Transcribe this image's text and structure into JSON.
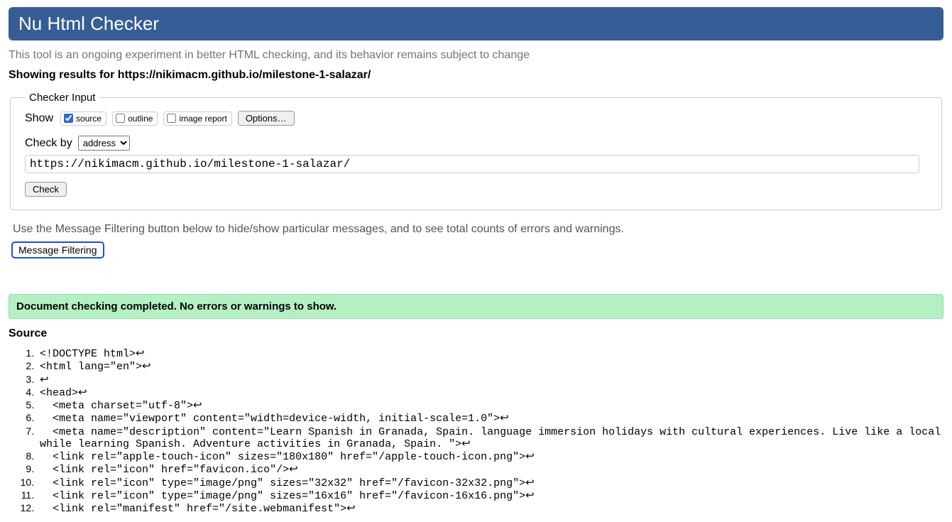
{
  "header": {
    "title": "Nu Html Checker"
  },
  "intro": "This tool is an ongoing experiment in better HTML checking, and its behavior remains subject to change",
  "showing": "Showing results for https://nikimacm.github.io/milestone-1-salazar/",
  "checker": {
    "legend": "Checker Input",
    "show_label": "Show",
    "cb_source": "source",
    "cb_outline": "outline",
    "cb_image_report": "image report",
    "options_btn": "Options…",
    "check_by_label": "Check by",
    "check_by_options": [
      "address"
    ],
    "check_by_selected": "address",
    "url_value": "https://nikimacm.github.io/milestone-1-salazar/",
    "check_btn": "Check"
  },
  "filter_hint": "Use the Message Filtering button below to hide/show particular messages, and to see total counts of errors and warnings.",
  "msg_filter_btn": "Message Filtering",
  "success_bar": "Document checking completed. No errors or warnings to show.",
  "source_heading": "Source",
  "source_lines": [
    "<!DOCTYPE html>↩",
    "<html lang=\"en\">↩",
    "↩",
    "<head>↩",
    "  <meta charset=\"utf-8\">↩",
    "  <meta name=\"viewport\" content=\"width=device-width, initial-scale=1.0\">↩",
    "  <meta name=\"description\" content=\"Learn Spanish in Granada, Spain. language immersion holidays with cultural experiences. Live like a local while learning Spanish. Adventure activities in Granada, Spain. \">↩",
    "  <link rel=\"apple-touch-icon\" sizes=\"180x180\" href=\"/apple-touch-icon.png\">↩",
    "  <link rel=\"icon\" href=\"favicon.ico\"/>↩",
    "  <link rel=\"icon\" type=\"image/png\" sizes=\"32x32\" href=\"/favicon-32x32.png\">↩",
    "  <link rel=\"icon\" type=\"image/png\" sizes=\"16x16\" href=\"/favicon-16x16.png\">↩",
    "  <link rel=\"manifest\" href=\"/site.webmanifest\">↩"
  ]
}
